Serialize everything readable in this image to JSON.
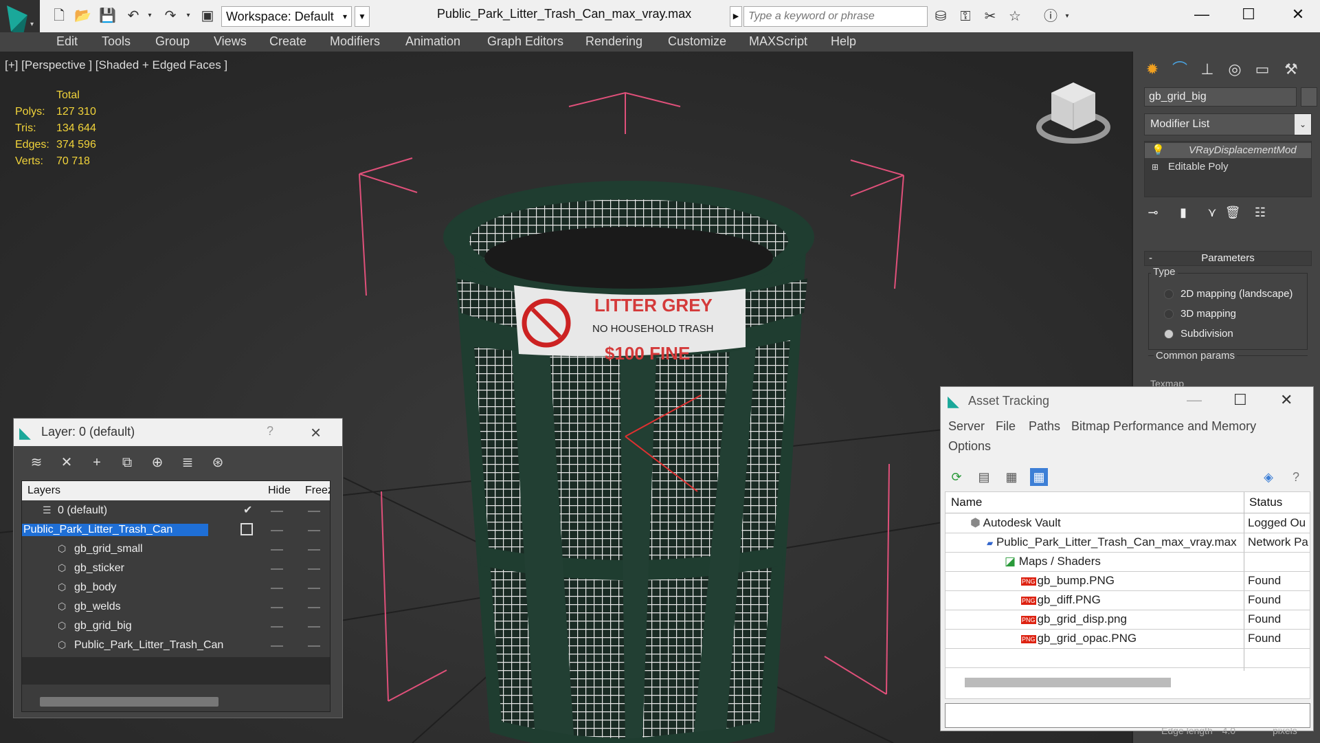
{
  "toolbar": {
    "workspace_label": "Workspace: Default",
    "file_title": "Public_Park_Litter_Trash_Can_max_vray.max",
    "search_placeholder": "Type a keyword or phrase"
  },
  "menu": [
    "Edit",
    "Tools",
    "Group",
    "Views",
    "Create",
    "Modifiers",
    "Animation",
    "Graph Editors",
    "Rendering",
    "Customize",
    "MAXScript",
    "Help"
  ],
  "viewport": {
    "label": "[+] [Perspective ] [Shaded + Edged Faces ]",
    "stats": {
      "total_label": "Total",
      "rows": [
        {
          "label": "Polys:",
          "value": "127 310"
        },
        {
          "label": "Tris:",
          "value": "134 644"
        },
        {
          "label": "Edges:",
          "value": "374 596"
        },
        {
          "label": "Verts:",
          "value": "70 718"
        }
      ]
    },
    "sticker": {
      "line1": "LITTER GREY",
      "line2": "NO HOUSEHOLD TRASH",
      "line3": "$100 FINE"
    }
  },
  "command_panel": {
    "object_name": "gb_grid_big",
    "modifier_list": "Modifier List",
    "stack": [
      "VRayDisplacementMod",
      "Editable Poly"
    ],
    "params_title": "Parameters",
    "type_title": "Type",
    "type_options": [
      {
        "label": "2D mapping (landscape)",
        "selected": false
      },
      {
        "label": "3D mapping",
        "selected": false
      },
      {
        "label": "Subdivision",
        "selected": true
      }
    ],
    "common_title": "Common params",
    "texmap_label": "Texmap"
  },
  "layer_dialog": {
    "title": "Layer: 0 (default)",
    "help": "?",
    "columns": {
      "layers": "Layers",
      "hide": "Hide",
      "freeze": "Freez"
    },
    "rows": [
      {
        "name": "0 (default)",
        "level": 0,
        "checked": true
      },
      {
        "name": "Public_Park_Litter_Trash_Can",
        "level": 0,
        "selected": true
      },
      {
        "name": "gb_grid_small",
        "level": 1
      },
      {
        "name": "gb_sticker",
        "level": 1
      },
      {
        "name": "gb_body",
        "level": 1
      },
      {
        "name": "gb_welds",
        "level": 1
      },
      {
        "name": "gb_grid_big",
        "level": 1
      },
      {
        "name": "Public_Park_Litter_Trash_Can",
        "level": 1
      }
    ]
  },
  "asset_dialog": {
    "title": "Asset Tracking",
    "menu": [
      "Server",
      "File",
      "Paths",
      "Bitmap Performance and Memory",
      "Options"
    ],
    "columns": {
      "name": "Name",
      "status": "Status"
    },
    "rows": [
      {
        "name": "Autodesk Vault",
        "status": "Logged Ou",
        "level": 1
      },
      {
        "name": "Public_Park_Litter_Trash_Can_max_vray.max",
        "status": "Network Pa",
        "level": 2
      },
      {
        "name": "Maps / Shaders",
        "status": "",
        "level": 3
      },
      {
        "name": "gb_bump.PNG",
        "status": "Found",
        "level": 4
      },
      {
        "name": "gb_diff.PNG",
        "status": "Found",
        "level": 4
      },
      {
        "name": "gb_grid_disp.png",
        "status": "Found",
        "level": 4
      },
      {
        "name": "gb_grid_opac.PNG",
        "status": "Found",
        "level": 4
      }
    ]
  },
  "bottom": {
    "edge_length": "Edge length",
    "edge_value": "4.0",
    "pixels": "pixels"
  },
  "colors": {
    "selection": "#1f6fd6",
    "stats": "#f2d43a",
    "bin_green": "#1f3d30",
    "bbox": "#e0507a"
  }
}
